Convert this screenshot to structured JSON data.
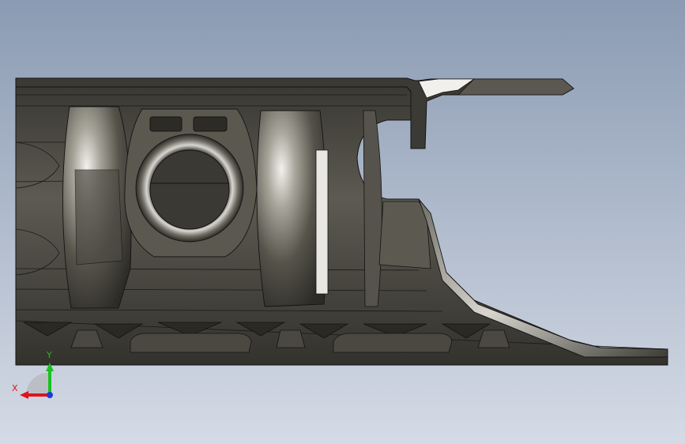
{
  "viewport": {
    "background_top": "#8b9bb3",
    "background_bottom": "#d5dbe6"
  },
  "model": {
    "body_color": "#4a4840",
    "edge_color": "#141414",
    "highlight_color": "#e8e6e0",
    "shadow_color": "#2a2924"
  },
  "triad": {
    "x_label": "X",
    "y_label": "Y",
    "x_color": "#e0141a",
    "y_color": "#17c21f",
    "z_color": "#1f3ad6"
  }
}
